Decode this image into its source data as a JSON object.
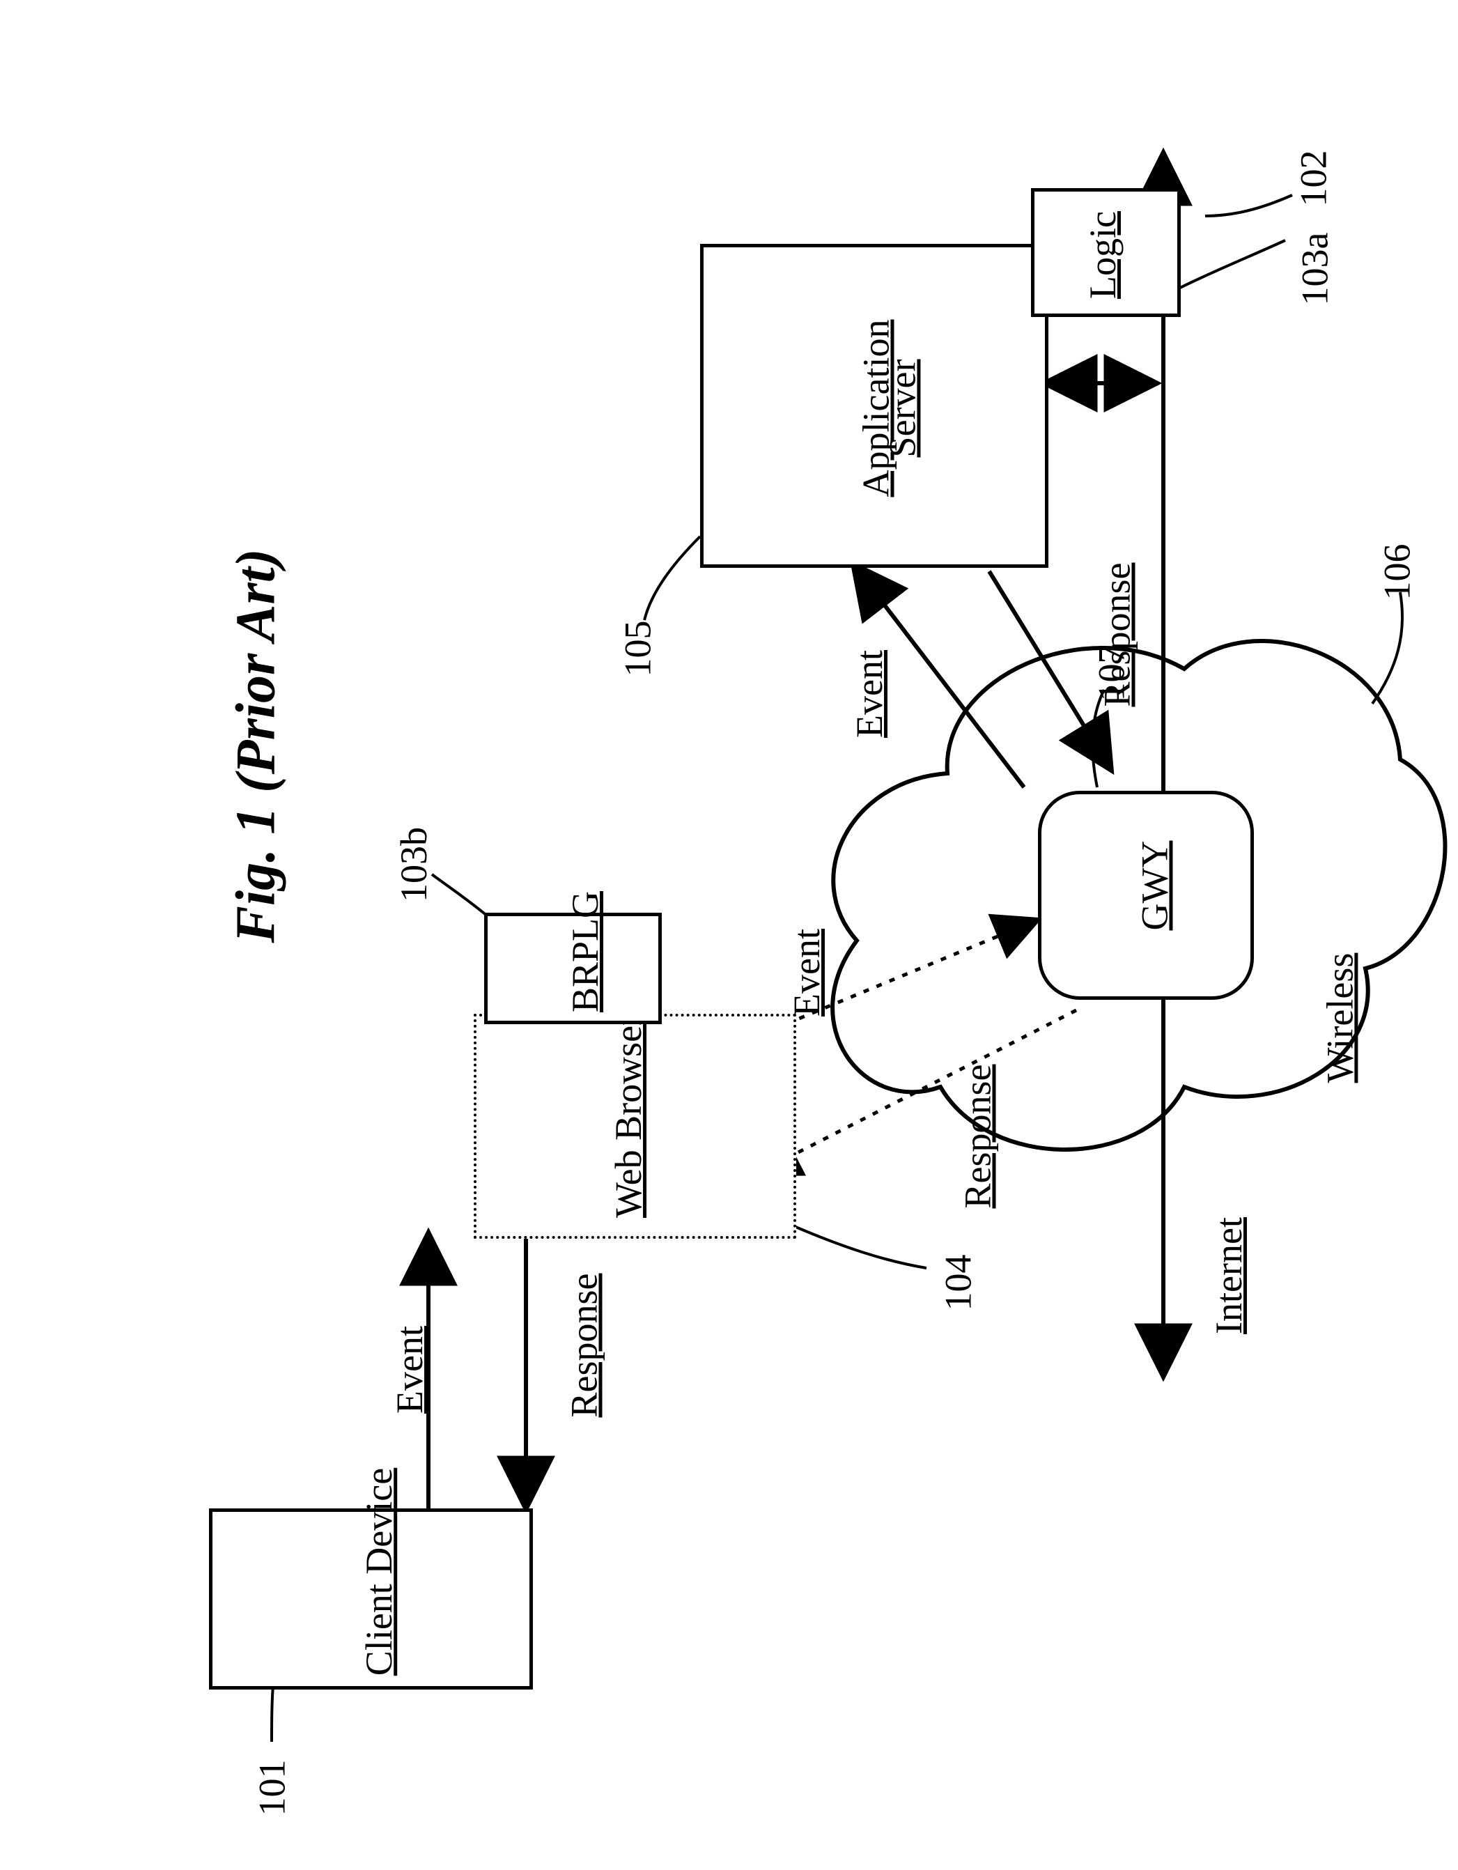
{
  "caption": "Fig. 1 (Prior Art)",
  "nodes": {
    "client_device": {
      "label": "Client Device",
      "ref": "101"
    },
    "web_browser": {
      "label": "Web Browser",
      "ref": "104"
    },
    "brplg": {
      "label": "BRPLG",
      "ref": "103b"
    },
    "app_server": {
      "label1": "Application",
      "label2": "Server",
      "ref": "105"
    },
    "logic": {
      "label": "Logic",
      "ref": "103a"
    },
    "gwy": {
      "label": "GWY",
      "ref": "107"
    },
    "wireless": {
      "label": "Wireless",
      "ref": "106"
    },
    "internet": {
      "label": "Internet",
      "ref": "102"
    }
  },
  "edges": {
    "client_browser": {
      "event": "Event",
      "response": "Response"
    },
    "browser_gwy": {
      "event": "Event",
      "response": "Response"
    },
    "gwy_server": {
      "event": "Event",
      "response": "Response"
    }
  }
}
